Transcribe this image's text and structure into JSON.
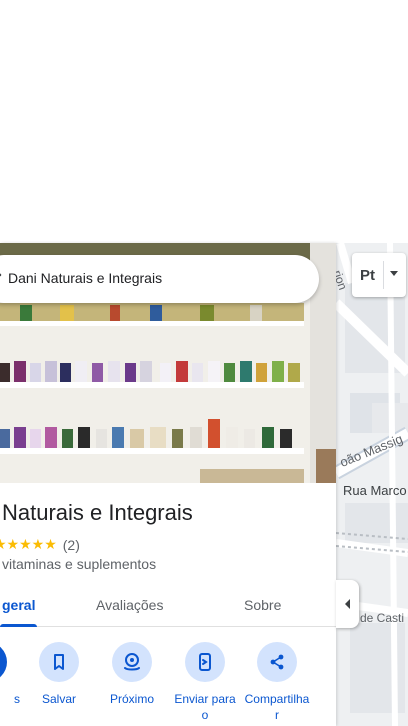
{
  "search": {
    "query": "Dani Naturais e Integrais"
  },
  "place": {
    "title": "Naturais e Integrais",
    "stars": "★★★★★",
    "rating_count": "(2)",
    "category": "vitaminas e suplementos"
  },
  "tabs": [
    {
      "label": "geral",
      "active": true
    },
    {
      "label": "Avaliações",
      "active": false
    },
    {
      "label": "Sobre",
      "active": false
    }
  ],
  "actions": [
    {
      "label": "s",
      "icon": "directions-icon"
    },
    {
      "label": "Salvar",
      "icon": "bookmark-icon"
    },
    {
      "label": "Próximo",
      "icon": "nearby-icon"
    },
    {
      "label": "Enviar para o",
      "icon": "send-to-phone-icon"
    },
    {
      "label": "Compartilha r",
      "icon": "share-icon"
    }
  ],
  "map": {
    "language_button": "Pt",
    "streets": [
      {
        "label": "oão Massig"
      },
      {
        "label": "Rua Marco"
      },
      {
        "label": "de Casti"
      },
      {
        "label": "rion"
      }
    ]
  },
  "colors": {
    "accent": "#0b57d0",
    "accent_light": "#d3e3fd",
    "star": "#fbbc04"
  }
}
